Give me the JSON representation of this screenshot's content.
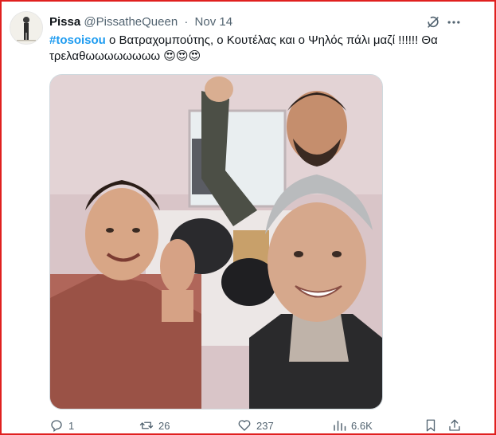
{
  "tweet": {
    "display_name": "Pissa",
    "handle": "@PissatheQueen",
    "separator": "·",
    "date": "Nov 14",
    "hashtag": "#tosoisou",
    "text_line1_rest": " ο Βατραχομπούτης, ο Κουτέλας και ο Ψηλός πάλι μαζί !!!!!! Θα",
    "text_line2": "τρελαθωωωωωωωω 😍😍😍"
  },
  "actions": {
    "replies": "1",
    "reposts": "26",
    "likes": "237",
    "views": "6.6K"
  },
  "icons": {
    "grok": "grok-icon",
    "more": "more-icon",
    "reply": "reply-icon",
    "repost": "repost-icon",
    "like": "heart-icon",
    "views": "views-icon",
    "bookmark": "bookmark-icon",
    "share": "share-icon"
  },
  "colors": {
    "accent": "#1d9bf0",
    "muted": "#536471",
    "frame": "#e0201f"
  }
}
